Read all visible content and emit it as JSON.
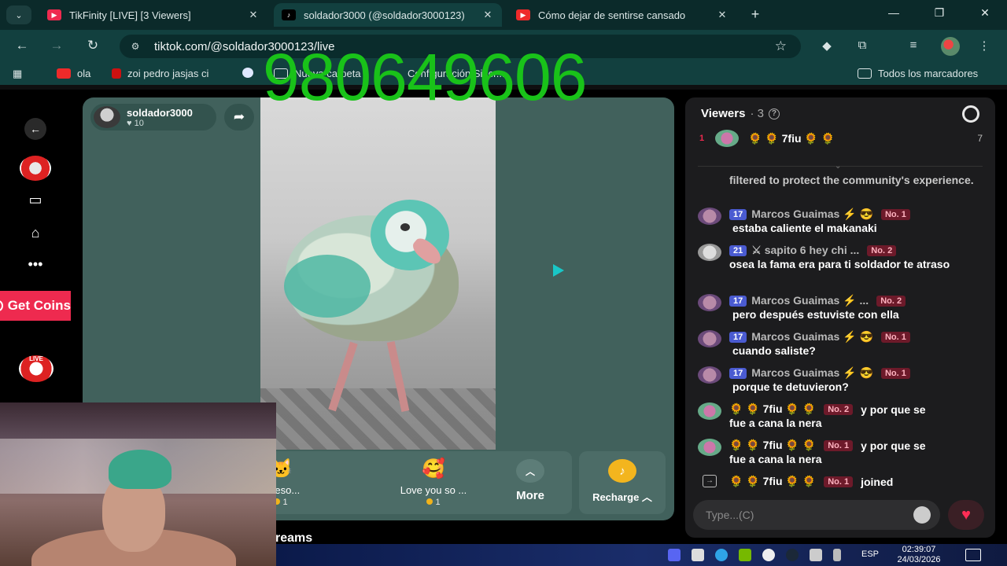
{
  "browser": {
    "tabs": [
      {
        "title": "TikFinity [LIVE] [3 Viewers]",
        "favicon": "youtube-icon",
        "active": false
      },
      {
        "title": "soldador3000 (@soldador3000123)",
        "favicon": "tiktok-icon",
        "active": true
      },
      {
        "title": "Cómo dejar de sentirse cansado",
        "favicon": "youtube-icon",
        "active": false
      }
    ],
    "url": "tiktok.com/@soldador3000123/live",
    "bookmarks": [
      {
        "label": "ola",
        "icon": "youtube-icon"
      },
      {
        "label": "zoi pedro jasjas ci",
        "icon": "netflix-icon"
      },
      {
        "label": "Nueva carpeta",
        "icon": "folder-icon"
      },
      {
        "label": "Configuración Sincr...",
        "icon": "gear-icon"
      }
    ],
    "all_bookmarks": "Todos los marcadores"
  },
  "overlay_text": "980649606",
  "sidebar": {
    "get_coins": "Get Coins",
    "live_badge": "LIVE"
  },
  "host": {
    "name": "soldador3000",
    "likes": "10"
  },
  "gifts": [
    {
      "name": "aweso...",
      "coins": "1",
      "icon": "cat-icon"
    },
    {
      "name": "Love you so ...",
      "coins": "1",
      "icon": "heart-face-icon"
    }
  ],
  "more_label": "More",
  "recharge_label": "Recharge",
  "streams_label": "reams",
  "chat": {
    "viewers_title": "Viewers",
    "viewers_count": "· 3",
    "top_viewer": {
      "rank": "1",
      "name": "🌻 🌻 7fiu 🌻 🌻",
      "score": "7"
    },
    "messages": [
      {
        "type": "system",
        "text": "filtered to protect the community's experience."
      },
      {
        "user": "Marcos Guaimas ⚡ 😎",
        "level": "17",
        "badge": "No. 1",
        "text": "estaba caliente el makanaki"
      },
      {
        "user": "⚔ sapito 6 hey chi ...",
        "level": "21",
        "badge": "No. 2",
        "text": "osea la fama era para ti soldador te atraso"
      },
      {
        "user": "Marcos Guaimas ⚡ ...",
        "level": "17",
        "badge": "No. 2",
        "text": "pero después estuviste con ella"
      },
      {
        "user": "Marcos Guaimas ⚡ 😎",
        "level": "17",
        "badge": "No. 1",
        "text": "cuando saliste?"
      },
      {
        "user": "Marcos Guaimas ⚡ 😎",
        "level": "17",
        "badge": "No. 1",
        "text": "porque te detuvieron?"
      },
      {
        "user": "🌻 🌻 7fiu 🌻 🌻",
        "badge": "No. 2",
        "inline": "y por que se",
        "text": "fue a cana la nera"
      },
      {
        "user": "🌻 🌻 7fiu 🌻 🌻",
        "badge": "No. 1",
        "inline": "y por que se",
        "text": "fue a cana la nera"
      },
      {
        "user": "🌻 🌻 7fiu 🌻 🌻",
        "badge": "No. 1",
        "inline": "joined"
      }
    ],
    "input_placeholder": "Type...(C)"
  },
  "taskbar": {
    "language": "ESP",
    "time": "02:39:07",
    "date": "24/03/2026"
  },
  "colors": {
    "accent_red": "#ee2a4f",
    "overlay_green": "#19c219",
    "level_blue": "#4a5bd1",
    "browser_teal": "#12403f"
  }
}
